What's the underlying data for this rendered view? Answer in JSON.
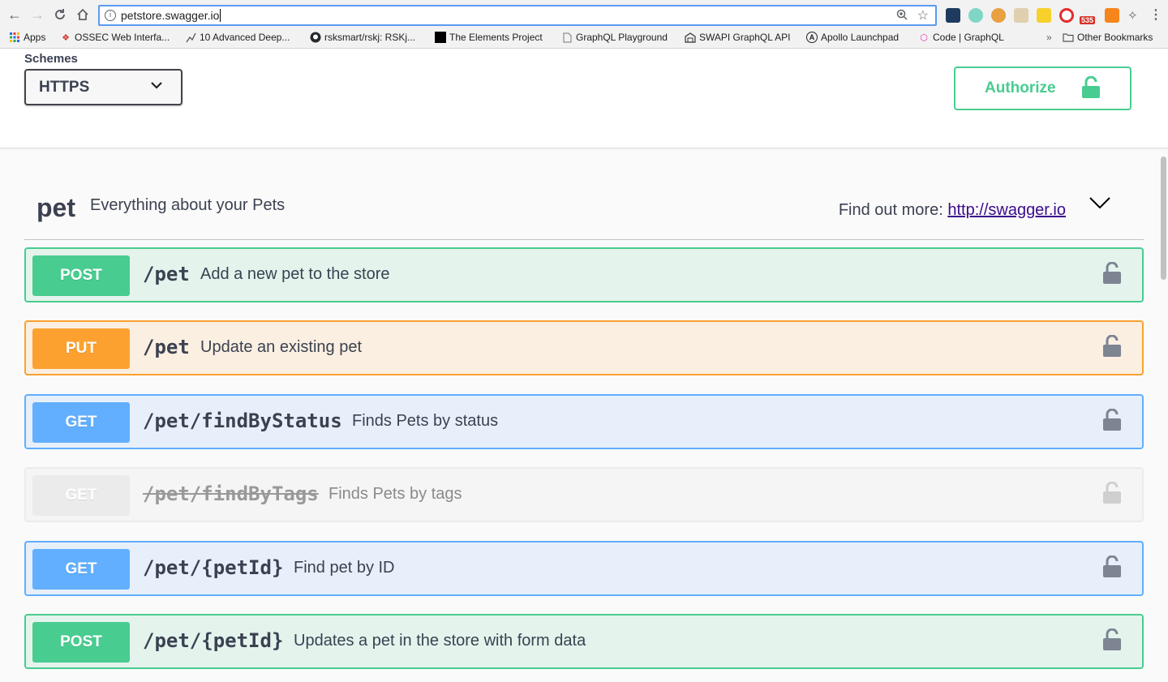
{
  "browser": {
    "url": "petstore.swagger.io",
    "ext_badge": "535",
    "bookmarks": [
      {
        "label": "Apps"
      },
      {
        "label": "OSSEC Web Interfa..."
      },
      {
        "label": "10 Advanced Deep..."
      },
      {
        "label": "rsksmart/rskj: RSKj..."
      },
      {
        "label": "The Elements Project"
      },
      {
        "label": "GraphQL Playground"
      },
      {
        "label": "SWAPI GraphQL API"
      },
      {
        "label": "Apollo Launchpad"
      },
      {
        "label": "Code | GraphQL"
      },
      {
        "label": "Other Bookmarks"
      }
    ],
    "more": "»"
  },
  "schemes": {
    "label": "Schemes",
    "selected": "HTTPS"
  },
  "authorize": {
    "label": "Authorize"
  },
  "tag": {
    "name": "pet",
    "description": "Everything about your Pets",
    "find_more_label": "Find out more:",
    "find_more_link": "http://swagger.io"
  },
  "operations": [
    {
      "method": "POST",
      "path": "/pet",
      "summary": "Add a new pet to the store"
    },
    {
      "method": "PUT",
      "path": "/pet",
      "summary": "Update an existing pet"
    },
    {
      "method": "GET",
      "path": "/pet/findByStatus",
      "summary": "Finds Pets by status"
    },
    {
      "method": "GET",
      "path": "/pet/findByTags",
      "summary": "Finds Pets by tags",
      "deprecated": true
    },
    {
      "method": "GET",
      "path": "/pet/{petId}",
      "summary": "Find pet by ID"
    },
    {
      "method": "POST",
      "path": "/pet/{petId}",
      "summary": "Updates a pet in the store with form data"
    }
  ],
  "colors": {
    "post": "#49cc90",
    "put": "#fca130",
    "get": "#61affe",
    "deprecated": "#ebebeb"
  }
}
